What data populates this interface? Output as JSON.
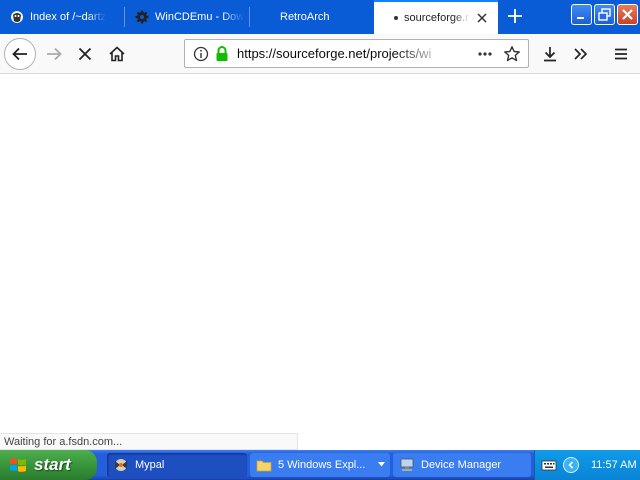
{
  "browser": {
    "tabs": [
      {
        "label": "Index of /~dartz",
        "active": false
      },
      {
        "label": "WinCDEmu - Dow",
        "active": false
      },
      {
        "label": "RetroArch",
        "active": false
      },
      {
        "label": "sourceforge.n",
        "active": true,
        "loading": true
      }
    ],
    "url": "https://sourceforge.net/projects/wi",
    "status_text": "Waiting for a.fsdn.com..."
  },
  "taskbar": {
    "start_label": "start",
    "tasks": [
      {
        "label": "Mypal",
        "active": true
      },
      {
        "label": "5 Windows Expl...",
        "active": false
      },
      {
        "label": "Device Manager",
        "active": false
      }
    ],
    "clock": "11:57 AM"
  },
  "colors": {
    "tabstrip": "#0a5cd6",
    "taskbar": "#245edb",
    "start_button": "#36933a",
    "tray": "#0f9ae8",
    "lock_green": "#12bc00"
  }
}
